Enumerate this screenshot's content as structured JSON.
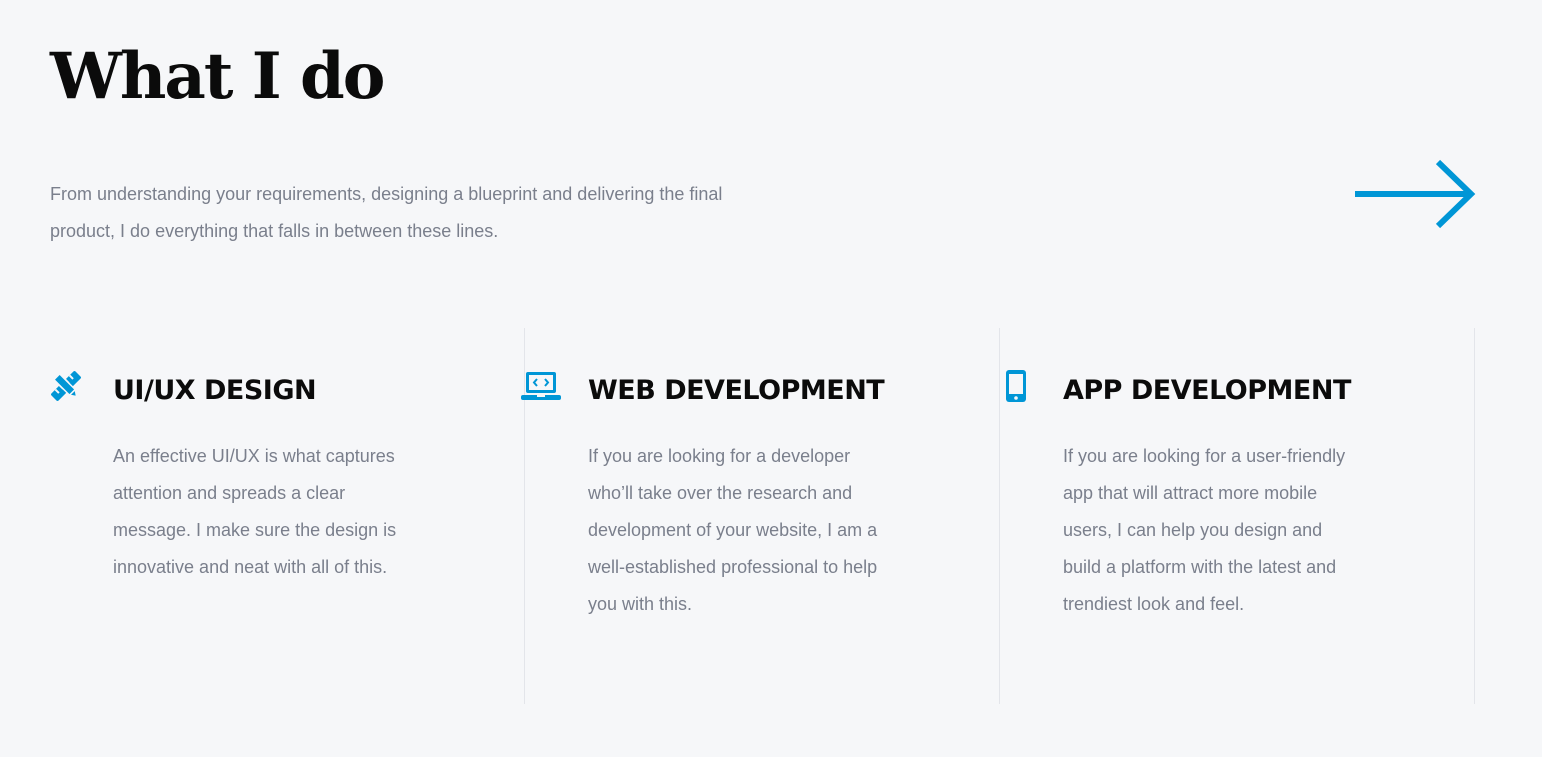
{
  "header": {
    "title": "What I do",
    "intro": "From understanding your requirements, designing a blueprint and delivering the final product, I do everything that falls in between these lines."
  },
  "navigation": {
    "next_arrow_icon": "arrow-right-icon"
  },
  "colors": {
    "accent": "#0096d6",
    "title": "#0b0b0b",
    "body_text": "#7a7f8c",
    "background": "#f6f7f9",
    "divider": "#e3e5ea"
  },
  "services": [
    {
      "icon": "pencil-ruler-icon",
      "title": "UI/UX DESIGN",
      "description": "An effective UI/UX is what captures attention and spreads a clear message. I make sure the design is innovative and neat with all of this."
    },
    {
      "icon": "laptop-code-icon",
      "title": "WEB DEVELOPMENT",
      "description": "If you are looking for a developer who’ll take over the research and development of your website, I am a well-established professional to help you with this."
    },
    {
      "icon": "mobile-phone-icon",
      "title": "APP DEVELOPMENT",
      "description": "If you are looking for a user-friendly app that will attract more mobile users, I can help you design and build a platform with the latest and trendiest look and feel."
    }
  ]
}
